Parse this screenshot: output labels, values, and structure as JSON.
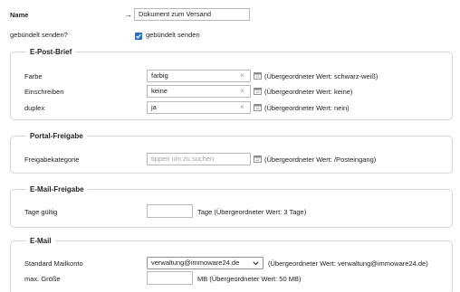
{
  "top": {
    "name_label": "Name",
    "name_arrow": "→",
    "name_value": "Dokument zum Versand",
    "bundled_label": "gebündelt senden?",
    "bundled_checkbox_label": "gebündelt senden",
    "bundled_checked": true
  },
  "epost": {
    "legend": "E-Post-Brief",
    "rows": [
      {
        "label": "Farbe",
        "value": "farbig",
        "parent": "(Übergeordneter Wert: schwarz-weiß)"
      },
      {
        "label": "Einschreiben",
        "value": "keine",
        "parent": "(Übergeordneter Wert: keine)"
      },
      {
        "label": "duplex",
        "value": "ja",
        "parent": "(Übergeordneter Wert: nein)"
      }
    ],
    "clear_glyph": "×"
  },
  "portal": {
    "legend": "Portal-Freigabe",
    "label": "Freigabekategorie",
    "placeholder": "tippen um zu suchen",
    "parent": "(Übergeordneter Wert: /Posteingang)"
  },
  "emailfreigabe": {
    "legend": "E-Mail-Freigabe",
    "label": "Tage gültig",
    "value": "",
    "suffix": "Tage (Übergeordneter Wert: 3 Tage)"
  },
  "email": {
    "legend": "E-Mail",
    "account_label": "Standard Mailkonto",
    "account_value": "verwaltung@immoware24.de",
    "account_parent": "(Übergeordneter Wert: verwaltung@immoware24.de)",
    "size_label": "max. Größe",
    "size_value": "",
    "size_suffix": "MB (Übergeordneter Wert: 50 MB)"
  },
  "colors": {
    "checkbox": "#1f6fd1",
    "border": "#d6d6d6",
    "input_border": "#b9b9b9"
  }
}
